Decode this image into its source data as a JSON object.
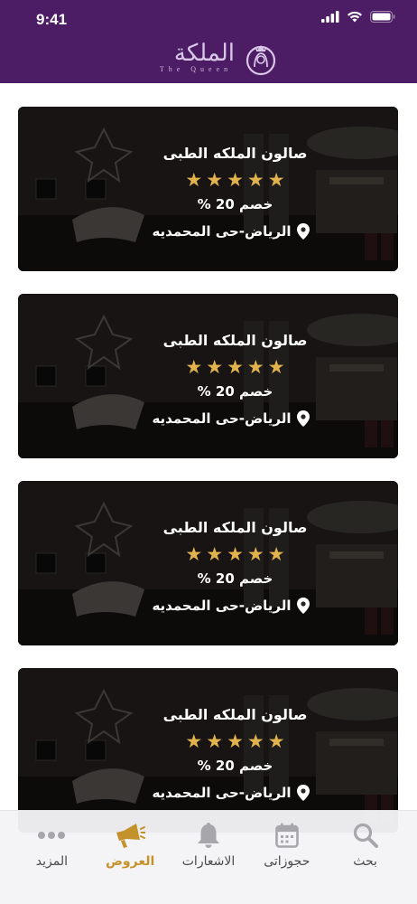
{
  "status_bar": {
    "time": "9:41"
  },
  "header": {
    "logo_text_ar": "الملكة",
    "logo_text_en": "The Queen"
  },
  "offers": [
    {
      "name": "صالون الملكه الطبى",
      "rating": 5,
      "discount": "خصم 20 %",
      "location": "الرياض-حى المحمديه"
    },
    {
      "name": "صالون الملكه الطبى",
      "rating": 5,
      "discount": "خصم 20 %",
      "location": "الرياض-حى المحمديه"
    },
    {
      "name": "صالون الملكه الطبى",
      "rating": 5,
      "discount": "خصم 20 %",
      "location": "الرياض-حى المحمديه"
    },
    {
      "name": "صالون الملكه الطبى",
      "rating": 5,
      "discount": "خصم 20 %",
      "location": "الرياض-حى المحمديه"
    }
  ],
  "bottom_nav": {
    "items": [
      {
        "label": "بحث",
        "icon": "search-icon",
        "active": false
      },
      {
        "label": "حجوزاتى",
        "icon": "calendar-icon",
        "active": false
      },
      {
        "label": "الاشعارات",
        "icon": "bell-icon",
        "active": false
      },
      {
        "label": "العروض",
        "icon": "megaphone-icon",
        "active": true
      },
      {
        "label": "المزيد",
        "icon": "more-dots-icon",
        "active": false
      }
    ]
  },
  "colors": {
    "header_bg": "#4c1c64",
    "star": "#e2b24d",
    "nav_active": "#c4922b",
    "nav_inactive_icon": "#a7a7ab"
  }
}
